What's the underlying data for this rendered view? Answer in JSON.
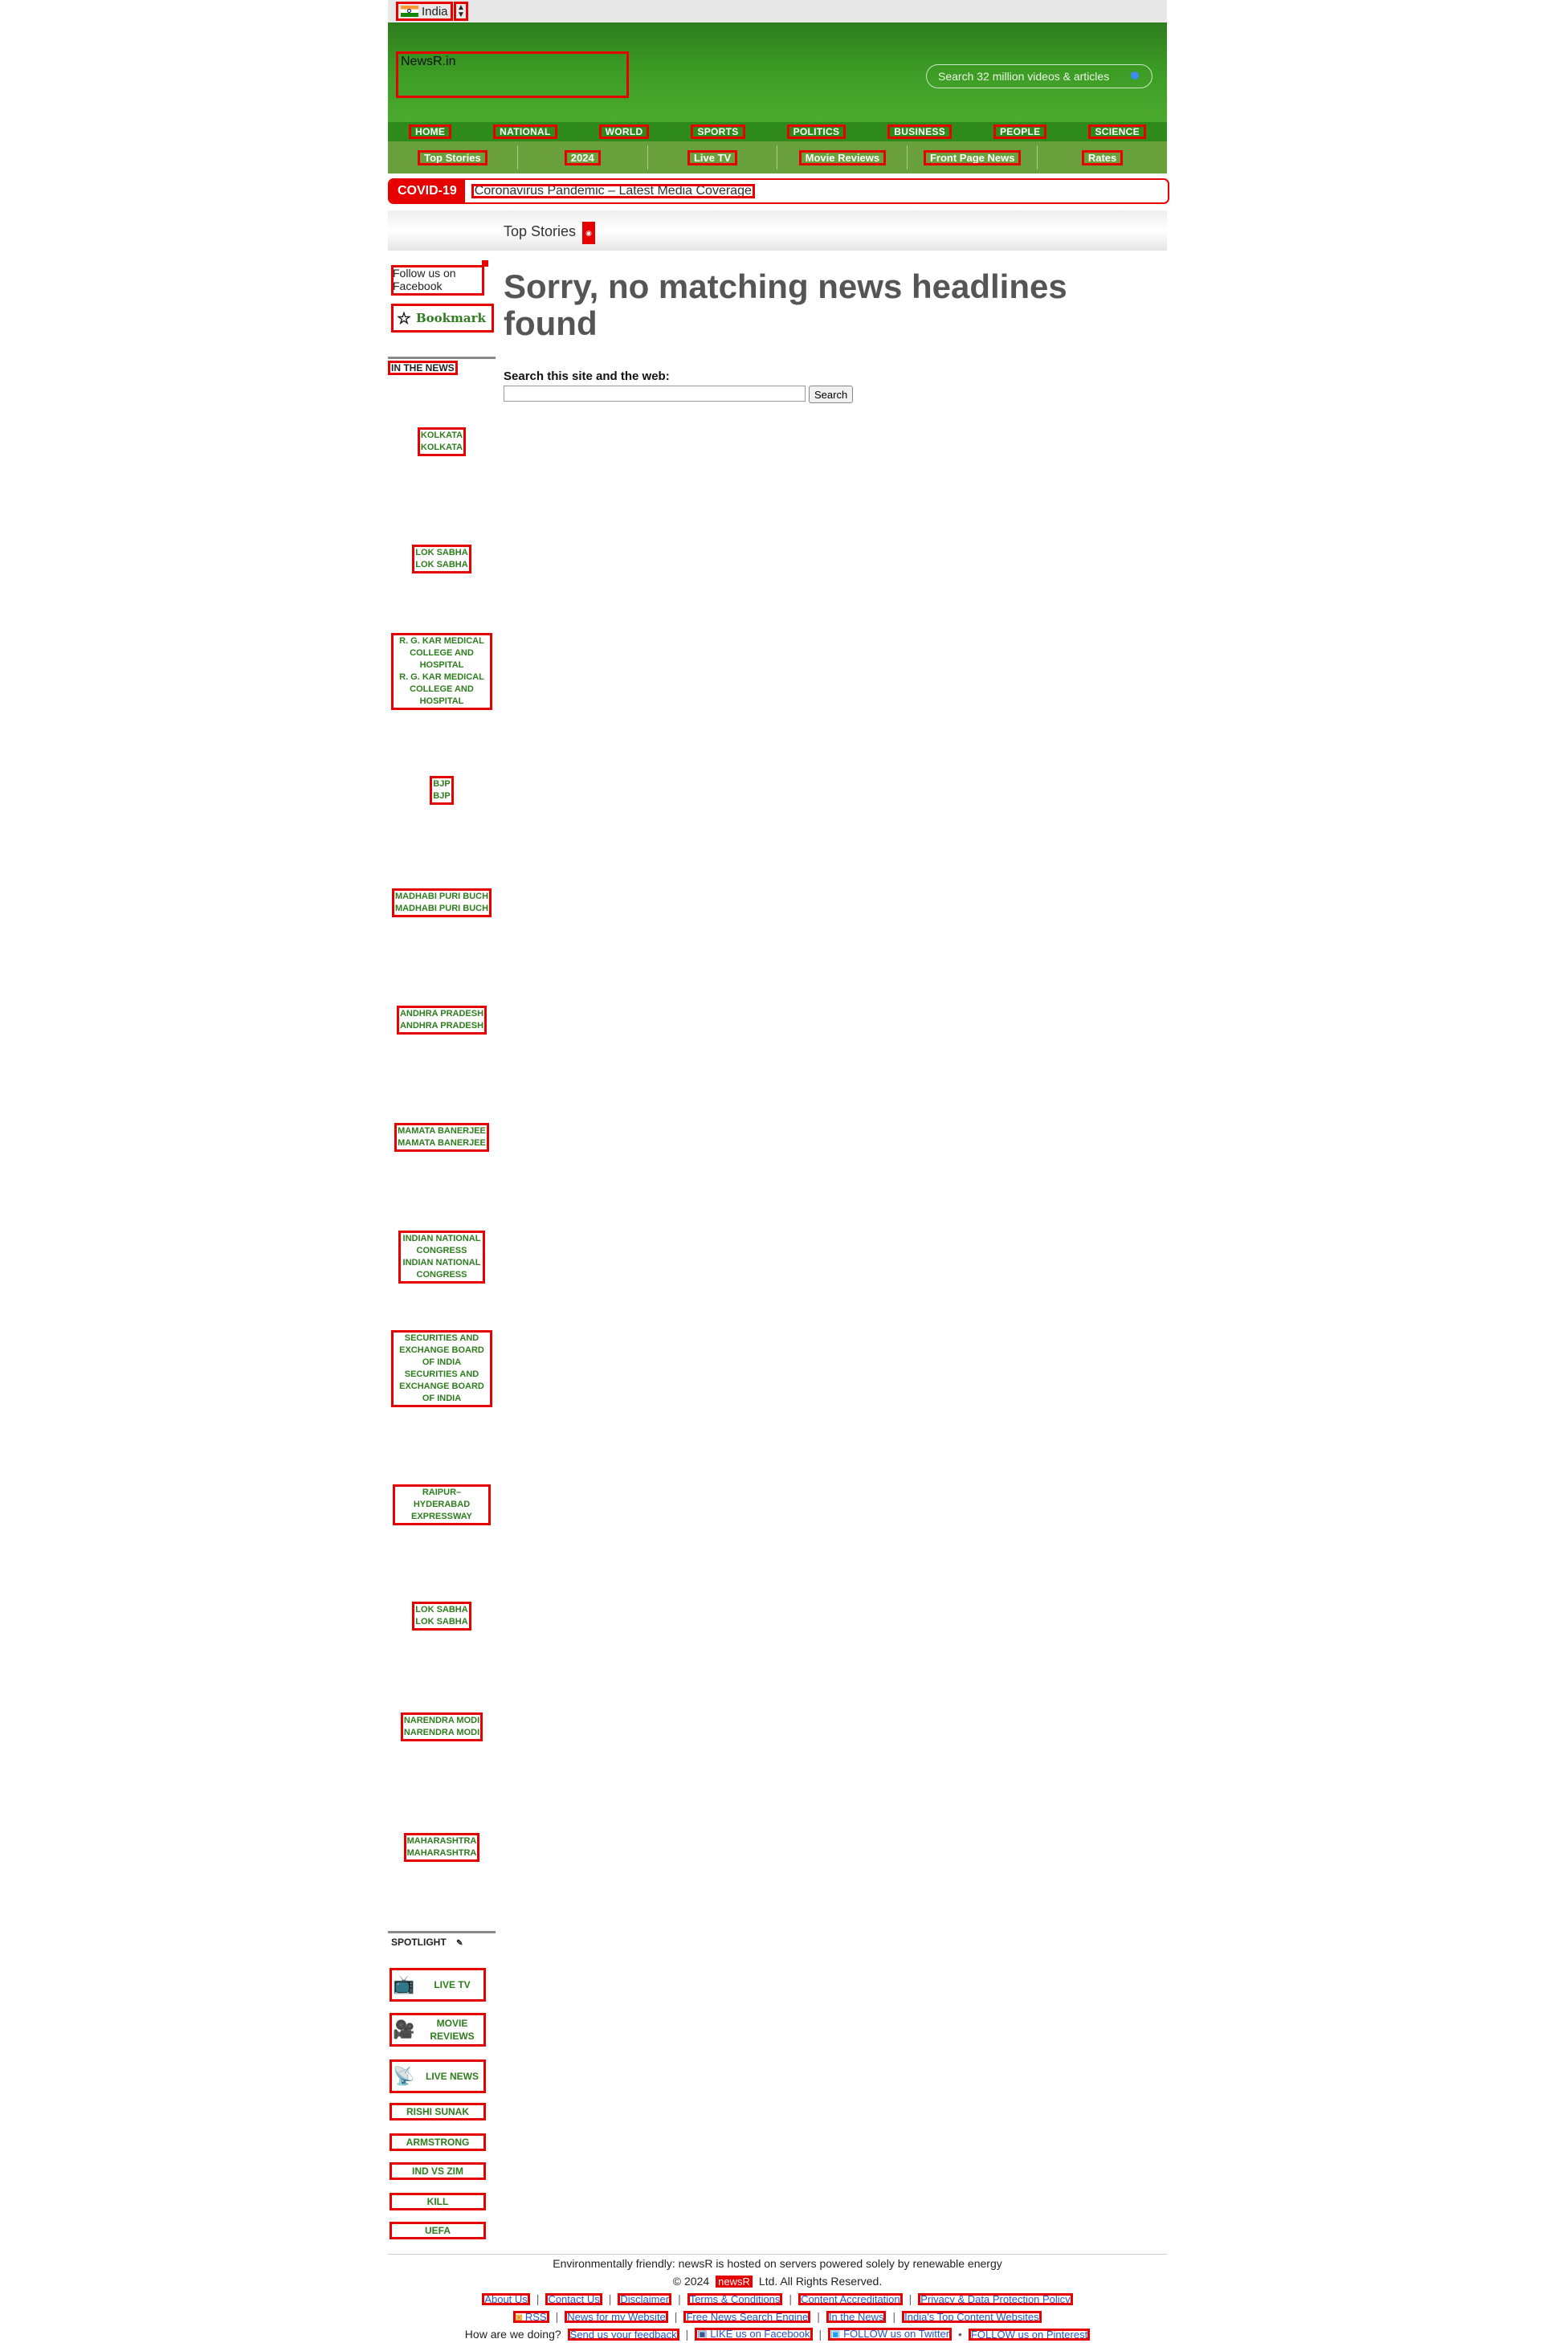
{
  "country": {
    "label": "India"
  },
  "header": {
    "logo_text": "NewsR.in",
    "search_text": "Search 32 million videos & articles"
  },
  "nav_primary": [
    "HOME",
    "NATIONAL",
    "WORLD",
    "SPORTS",
    "POLITICS",
    "BUSINESS",
    "PEOPLE",
    "SCIENCE"
  ],
  "nav_secondary": [
    "Top Stories",
    "2024",
    "Live TV",
    "Movie Reviews",
    "Front Page News",
    "Rates"
  ],
  "covid": {
    "tag": "COVID-19",
    "link": "Coronavirus Pandemic – Latest Media Coverage"
  },
  "breadcrumb": {
    "label": "Top Stories"
  },
  "sidebar": {
    "follow_fb": "Follow us on Facebook",
    "bookmark": "Bookmark",
    "in_the_news_title": "IN THE NEWS",
    "in_the_news": [
      {
        "label": "KOLKATA",
        "caption": "KOLKATA"
      },
      {
        "label": "LOK SABHA",
        "caption": "LOK SABHA"
      },
      {
        "label": "R. G. KAR MEDICAL COLLEGE AND HOSPITAL",
        "caption": "R. G. KAR MEDICAL COLLEGE AND HOSPITAL"
      },
      {
        "label": "BJP",
        "caption": "BJP"
      },
      {
        "label": "MADHABI PURI BUCH",
        "caption": "MADHABI PURI BUCH"
      },
      {
        "label": "ANDHRA PRADESH",
        "caption": "ANDHRA PRADESH"
      },
      {
        "label": "MAMATA BANERJEE",
        "caption": "MAMATA BANERJEE"
      },
      {
        "label": "INDIAN NATIONAL CONGRESS",
        "caption": "INDIAN NATIONAL CONGRESS"
      },
      {
        "label": "SECURITIES AND EXCHANGE BOARD OF INDIA",
        "caption": "SECURITIES AND EXCHANGE BOARD OF INDIA"
      },
      {
        "label": "RAIPUR–HYDERABAD EXPRESSWAY",
        "caption": "RAIPUR–HYDERABAD EXPRESSWAY"
      },
      {
        "label": "LOK SABHA",
        "caption": "LOK SABHA"
      },
      {
        "label": "NARENDRA MODI",
        "caption": "NARENDRA MODI"
      },
      {
        "label": "MAHARASHTRA",
        "caption": "MAHARASHTRA"
      }
    ],
    "spotlight_title": "SPOTLIGHT",
    "spotlight": [
      {
        "label": "LIVE TV",
        "icon": "tv-icon"
      },
      {
        "label": "MOVIE REVIEWS",
        "icon": "camera-icon"
      },
      {
        "label": "LIVE NEWS",
        "icon": "satellite-icon"
      }
    ],
    "spotlight_links": [
      "RISHI SUNAK",
      "ARMSTRONG",
      "IND VS ZIM",
      "KILL",
      "UEFA"
    ]
  },
  "main": {
    "heading": "Sorry, no matching news headlines found",
    "search_label": "Search this site and the web:",
    "search_value": "",
    "search_button": "Search"
  },
  "footer": {
    "eco": "Environmentally friendly: newsR is hosted on servers powered solely by renewable energy",
    "copyright_pre": "© 2024",
    "company": "newsR",
    "copyright_post": "Ltd. All Rights Reserved.",
    "links": [
      "About Us",
      "Contact Us",
      "Disclaimer",
      "Terms & Conditions",
      "Content Accreditation",
      "Privacy & Data Protection Policy"
    ],
    "links2": [
      "RSS",
      "News for my Website",
      "Free News Search Engine",
      "In the News",
      "India's Top Content Websites"
    ],
    "feedback_prompt": "How are we doing?",
    "feedback_link": "Send us your feedback",
    "social": [
      "LIKE us on Facebook",
      "FOLLOW us on Twitter",
      "FOLLOW us on Pinterest"
    ]
  }
}
